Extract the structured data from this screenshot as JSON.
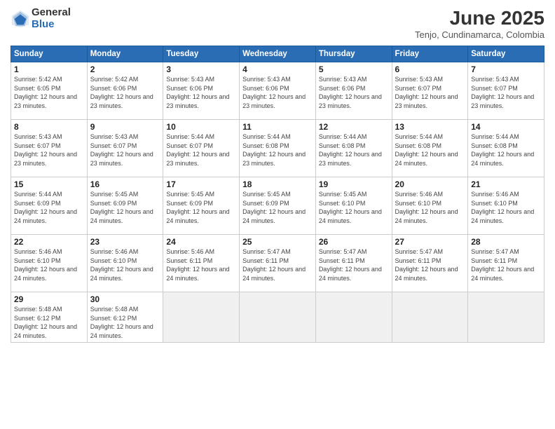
{
  "header": {
    "logo_general": "General",
    "logo_blue": "Blue",
    "month_title": "June 2025",
    "location": "Tenjo, Cundinamarca, Colombia"
  },
  "days_of_week": [
    "Sunday",
    "Monday",
    "Tuesday",
    "Wednesday",
    "Thursday",
    "Friday",
    "Saturday"
  ],
  "weeks": [
    [
      {
        "day": "1",
        "sunrise": "5:42 AM",
        "sunset": "6:05 PM",
        "daylight": "12 hours and 23 minutes."
      },
      {
        "day": "2",
        "sunrise": "5:42 AM",
        "sunset": "6:06 PM",
        "daylight": "12 hours and 23 minutes."
      },
      {
        "day": "3",
        "sunrise": "5:43 AM",
        "sunset": "6:06 PM",
        "daylight": "12 hours and 23 minutes."
      },
      {
        "day": "4",
        "sunrise": "5:43 AM",
        "sunset": "6:06 PM",
        "daylight": "12 hours and 23 minutes."
      },
      {
        "day": "5",
        "sunrise": "5:43 AM",
        "sunset": "6:06 PM",
        "daylight": "12 hours and 23 minutes."
      },
      {
        "day": "6",
        "sunrise": "5:43 AM",
        "sunset": "6:07 PM",
        "daylight": "12 hours and 23 minutes."
      },
      {
        "day": "7",
        "sunrise": "5:43 AM",
        "sunset": "6:07 PM",
        "daylight": "12 hours and 23 minutes."
      }
    ],
    [
      {
        "day": "8",
        "sunrise": "5:43 AM",
        "sunset": "6:07 PM",
        "daylight": "12 hours and 23 minutes."
      },
      {
        "day": "9",
        "sunrise": "5:43 AM",
        "sunset": "6:07 PM",
        "daylight": "12 hours and 23 minutes."
      },
      {
        "day": "10",
        "sunrise": "5:44 AM",
        "sunset": "6:07 PM",
        "daylight": "12 hours and 23 minutes."
      },
      {
        "day": "11",
        "sunrise": "5:44 AM",
        "sunset": "6:08 PM",
        "daylight": "12 hours and 23 minutes."
      },
      {
        "day": "12",
        "sunrise": "5:44 AM",
        "sunset": "6:08 PM",
        "daylight": "12 hours and 23 minutes."
      },
      {
        "day": "13",
        "sunrise": "5:44 AM",
        "sunset": "6:08 PM",
        "daylight": "12 hours and 24 minutes."
      },
      {
        "day": "14",
        "sunrise": "5:44 AM",
        "sunset": "6:08 PM",
        "daylight": "12 hours and 24 minutes."
      }
    ],
    [
      {
        "day": "15",
        "sunrise": "5:44 AM",
        "sunset": "6:09 PM",
        "daylight": "12 hours and 24 minutes."
      },
      {
        "day": "16",
        "sunrise": "5:45 AM",
        "sunset": "6:09 PM",
        "daylight": "12 hours and 24 minutes."
      },
      {
        "day": "17",
        "sunrise": "5:45 AM",
        "sunset": "6:09 PM",
        "daylight": "12 hours and 24 minutes."
      },
      {
        "day": "18",
        "sunrise": "5:45 AM",
        "sunset": "6:09 PM",
        "daylight": "12 hours and 24 minutes."
      },
      {
        "day": "19",
        "sunrise": "5:45 AM",
        "sunset": "6:10 PM",
        "daylight": "12 hours and 24 minutes."
      },
      {
        "day": "20",
        "sunrise": "5:46 AM",
        "sunset": "6:10 PM",
        "daylight": "12 hours and 24 minutes."
      },
      {
        "day": "21",
        "sunrise": "5:46 AM",
        "sunset": "6:10 PM",
        "daylight": "12 hours and 24 minutes."
      }
    ],
    [
      {
        "day": "22",
        "sunrise": "5:46 AM",
        "sunset": "6:10 PM",
        "daylight": "12 hours and 24 minutes."
      },
      {
        "day": "23",
        "sunrise": "5:46 AM",
        "sunset": "6:10 PM",
        "daylight": "12 hours and 24 minutes."
      },
      {
        "day": "24",
        "sunrise": "5:46 AM",
        "sunset": "6:11 PM",
        "daylight": "12 hours and 24 minutes."
      },
      {
        "day": "25",
        "sunrise": "5:47 AM",
        "sunset": "6:11 PM",
        "daylight": "12 hours and 24 minutes."
      },
      {
        "day": "26",
        "sunrise": "5:47 AM",
        "sunset": "6:11 PM",
        "daylight": "12 hours and 24 minutes."
      },
      {
        "day": "27",
        "sunrise": "5:47 AM",
        "sunset": "6:11 PM",
        "daylight": "12 hours and 24 minutes."
      },
      {
        "day": "28",
        "sunrise": "5:47 AM",
        "sunset": "6:11 PM",
        "daylight": "12 hours and 24 minutes."
      }
    ],
    [
      {
        "day": "29",
        "sunrise": "5:48 AM",
        "sunset": "6:12 PM",
        "daylight": "12 hours and 24 minutes."
      },
      {
        "day": "30",
        "sunrise": "5:48 AM",
        "sunset": "6:12 PM",
        "daylight": "12 hours and 24 minutes."
      },
      null,
      null,
      null,
      null,
      null
    ]
  ],
  "labels": {
    "sunrise_prefix": "Sunrise:",
    "sunset_prefix": "Sunset:",
    "daylight_prefix": "Daylight:"
  }
}
